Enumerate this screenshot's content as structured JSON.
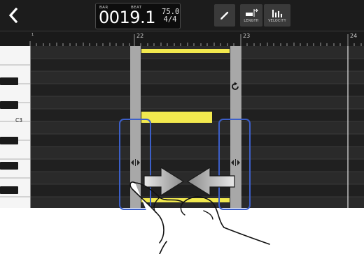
{
  "header": {
    "back_icon": "chevron-left-icon",
    "counter": {
      "bar_label": "BAR",
      "beat_label": "BEAT",
      "position": "0019.1",
      "tempo": "75.0",
      "time_signature": "4/4"
    },
    "tools": [
      {
        "id": "pencil",
        "icon": "pencil-icon",
        "label": ""
      },
      {
        "id": "length",
        "icon": "length-icon",
        "label": "LENGTH"
      },
      {
        "id": "velocity",
        "icon": "velocity-icon",
        "label": "VELOCITY"
      }
    ]
  },
  "ruler": {
    "measure_labels": [
      "1",
      "22",
      "23",
      "24"
    ]
  },
  "keyboard": {
    "note_label": "C3"
  },
  "colors": {
    "note": "#f2e94e",
    "highlight": "#3c5fc8",
    "frame": "#a8a8a8",
    "background": "#1a1a1a"
  },
  "gesture": {
    "type": "pinch-in",
    "icons": [
      "resize-handle-icon",
      "arrow-right-icon",
      "arrow-left-icon",
      "hand-pointer-icon",
      "loop-icon"
    ]
  }
}
